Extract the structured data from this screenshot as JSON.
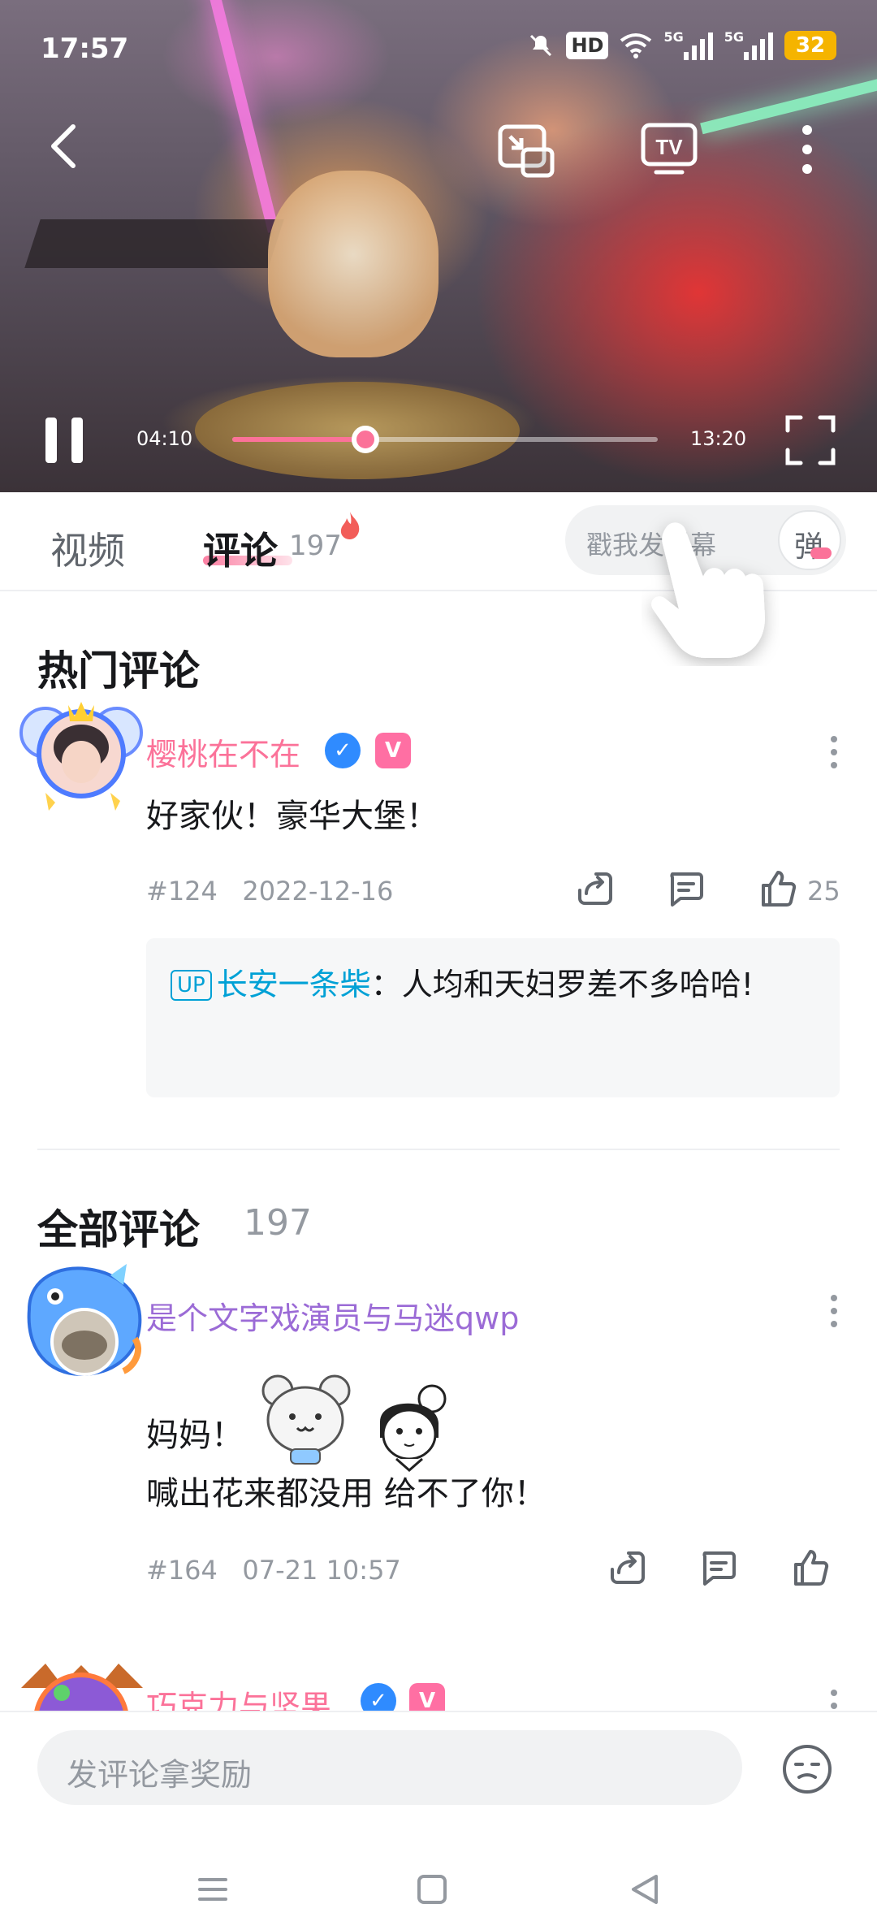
{
  "status_bar": {
    "time": "17:57",
    "hd": "HD",
    "net1": "5G",
    "net2": "5G",
    "battery": "32"
  },
  "player": {
    "current_time": "04:10",
    "total_time": "13:20",
    "progress_fraction": 0.3125,
    "accent_color": "#fb7299"
  },
  "tabs": {
    "video_label": "视频",
    "comments_label": "评论",
    "comments_count": "197",
    "danmaku_placeholder": "戳我发弹幕",
    "danmaku_button": "弹"
  },
  "hot_section": {
    "title": "热门评论",
    "comment": {
      "username": "樱桃在不在",
      "username_color": "#fb7299",
      "text": "好家伙！豪华大堡！",
      "floor": "#124",
      "date": "2022-12-16",
      "likes": "25",
      "reply": {
        "tag": "UP",
        "user": "长安一条柴",
        "separator": "：",
        "text": "人均和天妇罗差不多哈哈!"
      }
    }
  },
  "all_section": {
    "title": "全部评论",
    "count": "197",
    "comments": [
      {
        "username": "是个文字戏演员与马迷qwp",
        "username_color": "#9b6bd6",
        "line1": "妈妈！",
        "line2": "喊出花来都没用 给不了你！",
        "floor": "#164",
        "date": "07-21 10:57"
      },
      {
        "username": "巧克力与坚果",
        "username_color": "#fb7299"
      }
    ]
  },
  "bottom_bar": {
    "comment_placeholder": "发评论拿奖励"
  },
  "icons": [
    "back-icon",
    "pip-icon",
    "tv-icon",
    "more-icon",
    "pause-icon",
    "fullscreen-icon",
    "flame-icon",
    "share-icon",
    "reply-icon",
    "like-icon",
    "emoji-icon",
    "menu-icon",
    "home-icon",
    "back-nav-icon"
  ]
}
